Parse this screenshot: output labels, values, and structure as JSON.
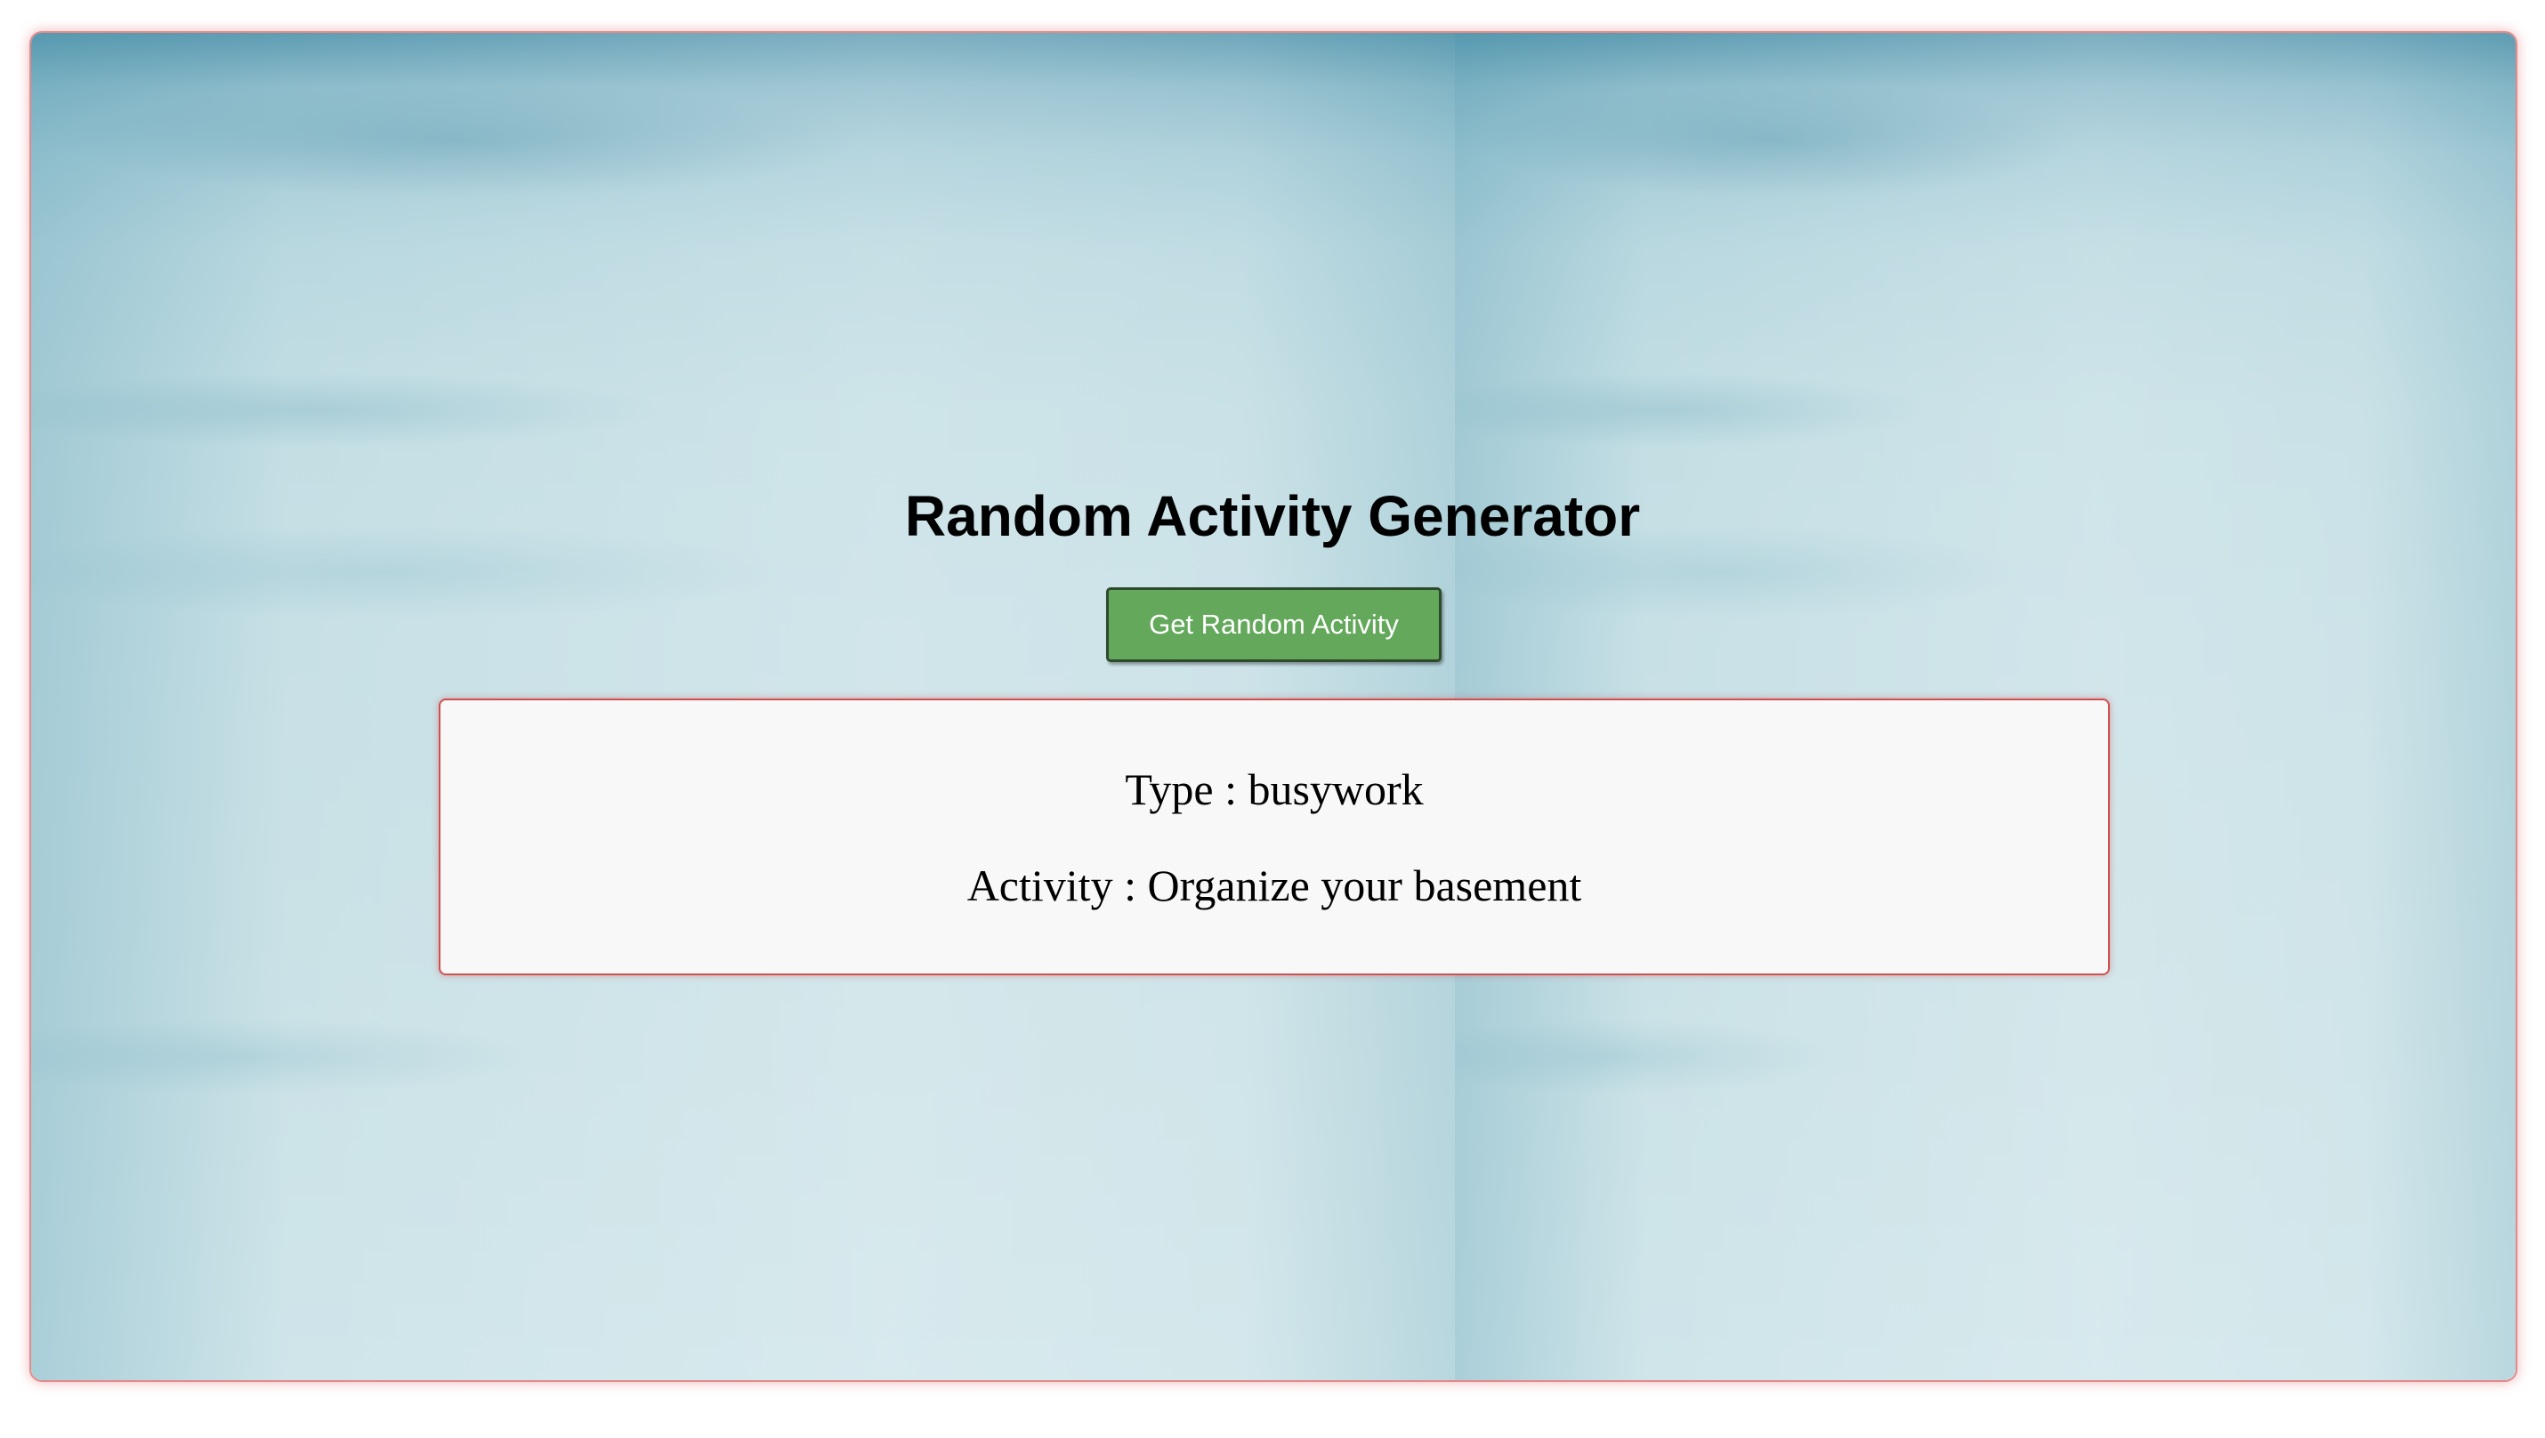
{
  "header": {
    "title": "Random Activity Generator"
  },
  "actions": {
    "get_button_label": "Get Random Activity"
  },
  "result": {
    "type_label": "Type",
    "separator": " : ",
    "type_value": "busywork",
    "activity_label": "Activity",
    "activity_value": "Organize your basement"
  },
  "colors": {
    "button_background": "#63a85b",
    "card_border": "#d05050",
    "card_background": "#f8f8f8",
    "frame_border": "#e58a8a"
  }
}
